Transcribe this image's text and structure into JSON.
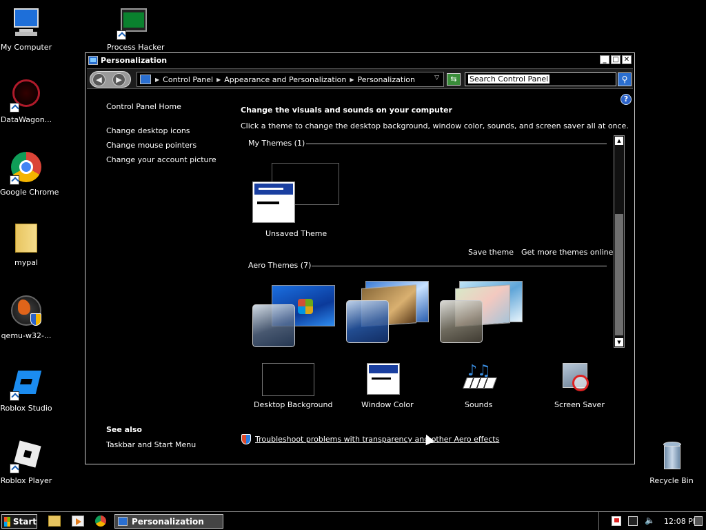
{
  "desktop": {
    "icons": [
      {
        "label": "My Computer"
      },
      {
        "label": "Process Hacker"
      },
      {
        "label": "DataWagon..."
      },
      {
        "label": "Google Chrome"
      },
      {
        "label": "mypal"
      },
      {
        "label": "qemu-w32-..."
      },
      {
        "label": "Roblox Studio"
      },
      {
        "label": "Roblox Player"
      },
      {
        "label": "Recycle Bin"
      }
    ]
  },
  "window": {
    "title": "Personalization",
    "address": {
      "crumbs": [
        "Control Panel",
        "Appearance and Personalization",
        "Personalization"
      ],
      "search_placeholder": "Search Control Panel"
    },
    "left_pane": {
      "home": "Control Panel Home",
      "links": [
        "Change desktop icons",
        "Change mouse pointers",
        "Change your account picture"
      ],
      "see_also_title": "See also",
      "see_also_links": [
        "Taskbar and Start Menu"
      ]
    },
    "main": {
      "heading": "Change the visuals and sounds on your computer",
      "subtext": "Click a theme to change the desktop background, window color, sounds, and screen saver all at once.",
      "my_themes_title": "My Themes (1)",
      "unsaved_theme": "Unsaved Theme",
      "save_theme": "Save theme",
      "get_more": "Get more themes online",
      "aero_themes_title": "Aero Themes (7)",
      "bottom_tiles": [
        "Desktop Background",
        "Window Color",
        "Sounds",
        "Screen Saver"
      ],
      "troubleshoot": "Troubleshoot problems with transparency and other Aero effects"
    }
  },
  "taskbar": {
    "start_label": "Start",
    "active_task": "Personalization",
    "clock": "12:08 PM"
  }
}
